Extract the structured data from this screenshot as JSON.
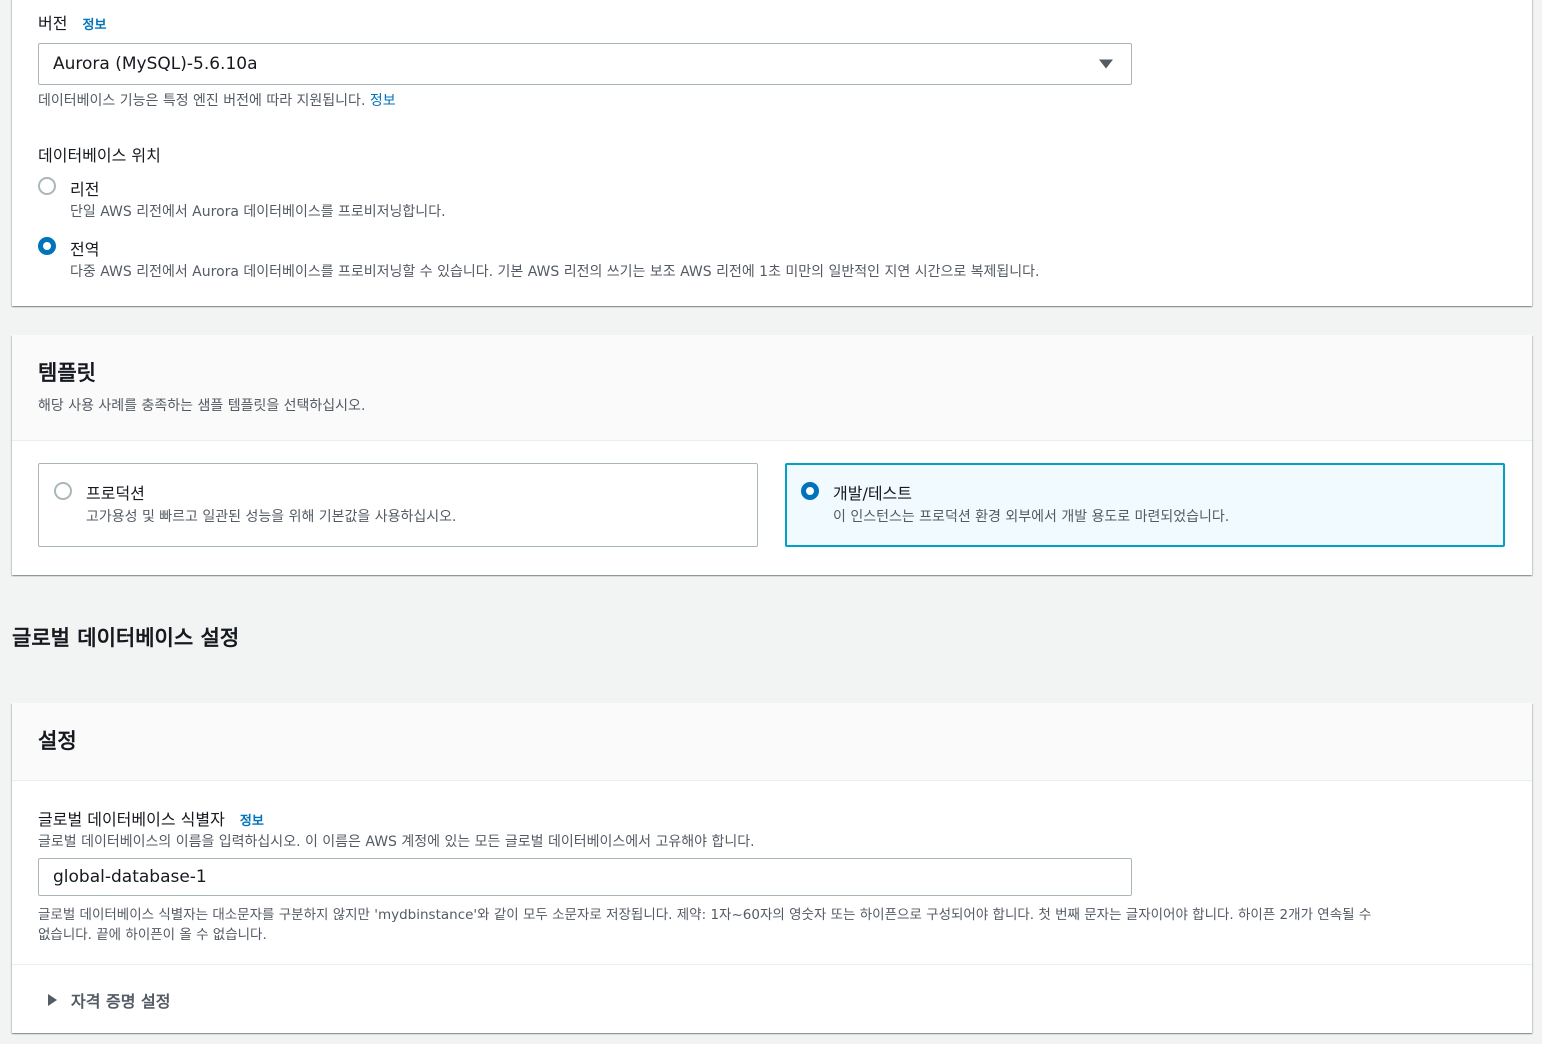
{
  "engine_panel": {
    "version_label": "버전",
    "version_info": "정보",
    "version_selected": "Aurora (MySQL)-5.6.10a",
    "version_desc": "데이터베이스 기능은 특정 엔진 버전에 따라 지원됩니다.",
    "version_desc_info": "정보",
    "location_label": "데이터베이스 위치",
    "location_options": [
      {
        "label": "리전",
        "desc": "단일 AWS 리전에서 Aurora 데이터베이스를 프로비저닝합니다.",
        "selected": false
      },
      {
        "label": "전역",
        "desc": "다중 AWS 리전에서 Aurora 데이터베이스를 프로비저닝할 수 있습니다. 기본 AWS 리전의 쓰기는 보조 AWS 리전에 1초 미만의 일반적인 지연 시간으로 복제됩니다.",
        "selected": true
      }
    ]
  },
  "template_panel": {
    "title": "템플릿",
    "subtitle": "해당 사용 사례를 충족하는 샘플 템플릿을 선택하십시오.",
    "options": [
      {
        "label": "프로덕션",
        "desc": "고가용성 및 빠르고 일관된 성능을 위해 기본값을 사용하십시오.",
        "selected": false
      },
      {
        "label": "개발/테스트",
        "desc": "이 인스턴스는 프로덕션 환경 외부에서 개발 용도로 마련되었습니다.",
        "selected": true
      }
    ]
  },
  "global_section": {
    "heading": "글로벌 데이터베이스 설정"
  },
  "settings_panel": {
    "title": "설정",
    "identifier_label": "글로벌 데이터베이스 식별자",
    "identifier_info": "정보",
    "identifier_desc": "글로벌 데이터베이스의 이름을 입력하십시오. 이 이름은 AWS 계정에 있는 모든 글로벌 데이터베이스에서 고유해야 합니다.",
    "identifier_value": "global-database-1",
    "identifier_constraint_line1": "글로벌 데이터베이스 식별자는 대소문자를 구분하지 않지만 'mydbinstance'와 같이 모두 소문자로 저장됩니다. 제약: 1자~60자의 영숫자 또는 하이픈으로 구성되어야 합니다. 첫 번째 문자는 글자이어야 합니다. 하이픈 2개가 연속될 수",
    "identifier_constraint_line2": "없습니다. 끝에 하이픈이 올 수 없습니다.",
    "credentials_expander": "자격 증명 설정"
  },
  "colors": {
    "page_bg": "#f2f3f3",
    "link": "#0073bb",
    "selected_border": "#00a1c9",
    "selected_bg": "#f1faff"
  }
}
